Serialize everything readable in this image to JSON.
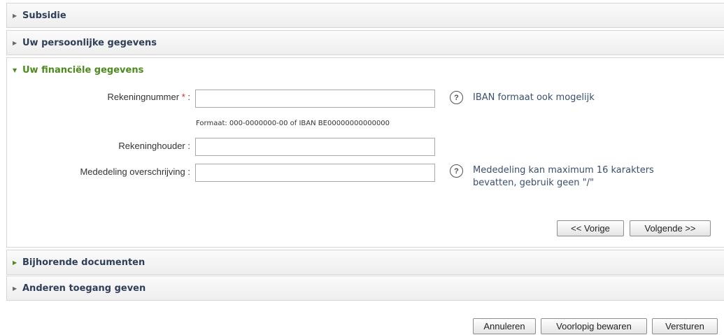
{
  "sections": {
    "subsidie": "Subsidie",
    "persoonlijk": "Uw persoonlijke gegevens",
    "financieel": "Uw financiële gegevens",
    "documenten": "Bijhorende documenten",
    "toegang": "Anderen toegang geven"
  },
  "form": {
    "rekeningnummer_label": "Rekeningnummer",
    "required_marker": "*",
    "colon": " :",
    "rekeningnummer_value": "",
    "rekeningnummer_help": "IBAN formaat ook mogelijk",
    "format_hint": "Formaat: 000-0000000-00 of IBAN BE00000000000000",
    "rekeninghouder_label": "Rekeninghouder :",
    "rekeninghouder_value": "",
    "mededeling_label": "Mededeling overschrijving :",
    "mededeling_value": "",
    "mededeling_help_line1": "Mededeling kan maximum 16 karakters",
    "mededeling_help_line2": "bevatten, gebruik geen \"/\"",
    "help_icon_glyph": "?"
  },
  "nav_buttons": {
    "vorige": "<< Vorige",
    "volgende": "Volgende >>"
  },
  "footer_buttons": {
    "annuleren": "Annuleren",
    "bewaren": "Voorlopig bewaren",
    "versturen": "Versturen"
  },
  "icons": {
    "collapsed": "triangle-right-icon",
    "expanded": "triangle-down-icon"
  },
  "colors": {
    "active_section": "#4d8a1e",
    "section_title": "#2f3f5a",
    "required": "#dd2222",
    "help_text": "#3a4f6e"
  }
}
